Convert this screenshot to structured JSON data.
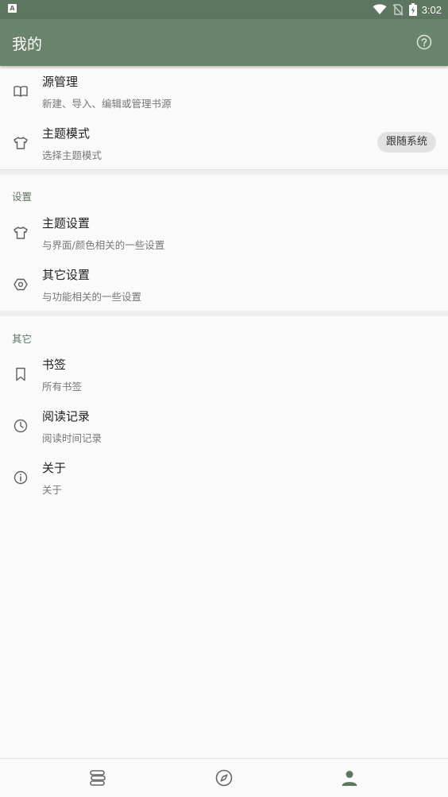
{
  "status_bar": {
    "notification_icon": "A",
    "time": "3:02",
    "icons": [
      "wifi-icon",
      "no-sim-icon",
      "battery-charging-icon"
    ]
  },
  "app_bar": {
    "title": "我的",
    "help_icon": "help-circle-icon"
  },
  "items_top": [
    {
      "title": "源管理",
      "subtitle": "新建、导入、编辑或管理书源",
      "icon": "book-open-icon"
    },
    {
      "title": "主题模式",
      "subtitle": "选择主题模式",
      "icon": "tshirt-icon",
      "value": "跟随系统"
    }
  ],
  "settings_section": {
    "header": "设置",
    "items": [
      {
        "title": "主题设置",
        "subtitle": "与界面/颜色相关的一些设置",
        "icon": "tshirt-icon"
      },
      {
        "title": "其它设置",
        "subtitle": "与功能相关的一些设置",
        "icon": "hex-nut-icon"
      }
    ]
  },
  "other_section": {
    "header": "其它",
    "items": [
      {
        "title": "书签",
        "subtitle": "所有书签",
        "icon": "bookmark-icon"
      },
      {
        "title": "阅读记录",
        "subtitle": "阅读时间记录",
        "icon": "clock-icon"
      },
      {
        "title": "关于",
        "subtitle": "关于",
        "icon": "info-icon"
      }
    ]
  },
  "bottom_nav": {
    "items": [
      {
        "icon": "bookshelf-icon",
        "active": false
      },
      {
        "icon": "compass-icon",
        "active": false
      },
      {
        "icon": "person-icon",
        "active": true
      }
    ]
  },
  "colors": {
    "primary": "#6a846c",
    "status_bar": "#5c765f",
    "accent_text": "#5c765f",
    "background": "#fafafa"
  }
}
